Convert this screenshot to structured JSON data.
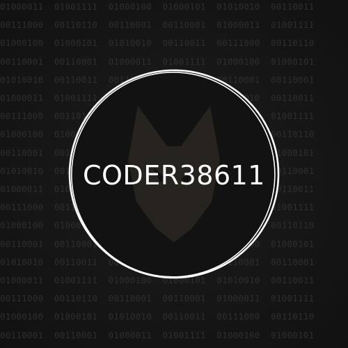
{
  "background": {
    "color": "#141414",
    "binary_color": "#2e2e2e",
    "binary_rows": [
      "01000011  01001111  01000100  01000101  01010010  00110011",
      "00111000  00110110  00110001  00110001  01000011  01001111",
      "01000100  01000101  01010010  00110011  00111000  00110110",
      "00110001  00110001  01000011  01001111  01000100  01000101",
      "01010010  00110011  00111000  00110110  00110001  00110001",
      "01000011  01001111  01000100  01000101  01010010  00110011",
      "00111000  00110110  00110001  00110001  01000011  01001111",
      "01000100  01000101  01010010  00110011  00111000  00110110",
      "00110001  00110001  01000011  01001111  01000100  01000101",
      "01010010  00110011  00111000  00110110  00110001  00110001",
      "01000011  01001111  01000100  01000101  01010010  00110011",
      "00111000  00110110  00110001  00110001  01000011  01001111",
      "01000100  01000101  01010010  00110011  00111000  00110110",
      "00110001  00110001  01000011  01001111  01000100  01000101",
      "01010010  00110011  00111000  00110110  00110001  00110001",
      "01000011  01001111  01000100  01000101  01010010  00110011",
      "00111000  00110110  00110001  00110001  01000011  01001111",
      "01000100  01000101  01010010  00110011  00111000  00110110",
      "00110001  00110001  01000011  01001111  01000100  01000101"
    ]
  },
  "logo": {
    "text": "CODER38611",
    "ring_color": "#ffffff",
    "fox_color": "#2a2722",
    "icon": "fox-head-icon"
  }
}
